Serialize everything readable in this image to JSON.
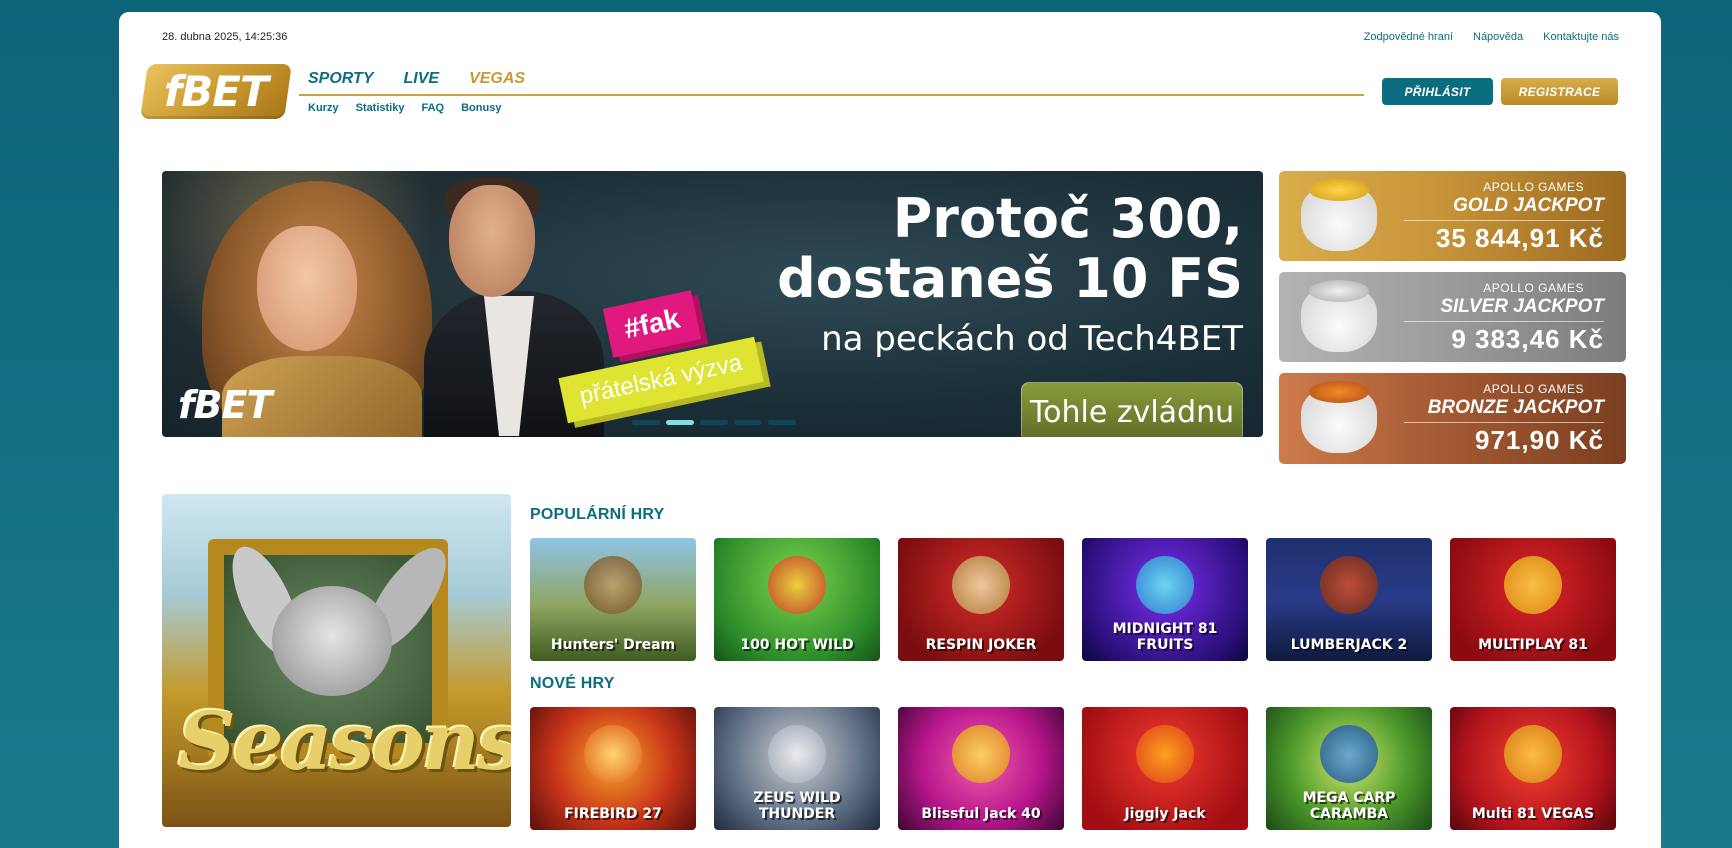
{
  "header": {
    "datetime": "28. dubna 2025, 14:25:36",
    "top_links": [
      "Zodpovědné hraní",
      "Nápověda",
      "Kontaktujte nás"
    ],
    "logo": "fBET",
    "main_nav": [
      "SPORTY",
      "LIVE",
      "VEGAS"
    ],
    "sub_nav": [
      "Kurzy",
      "Statistiky",
      "FAQ",
      "Bonusy"
    ],
    "login_label": "PŘIHLÁSIT",
    "register_label": "REGISTRACE"
  },
  "banner": {
    "logo": "fBET",
    "tag1": "#fak",
    "tag2": "přátelská výzva",
    "headline_line1": "Protoč 300,",
    "headline_line2": "dostaneš 10 FS",
    "headline_line3": "na peckách od Tech4BET",
    "cta_label": "Tohle zvládnu",
    "slide_count": 5,
    "active_slide": 2
  },
  "jackpots": [
    {
      "brand": "APOLLO GAMES",
      "name": "GOLD JACKPOT",
      "value": "35 844,91 Kč",
      "color": "#c9953a"
    },
    {
      "brand": "APOLLO GAMES",
      "name": "SILVER JACKPOT",
      "value": "9 383,46 Kč",
      "color": "#9d9d9d"
    },
    {
      "brand": "APOLLO GAMES",
      "name": "BRONZE JACKPOT",
      "value": "971,90 Kč",
      "color": "#a65b34"
    }
  ],
  "promo_tile": {
    "title": "Seasons"
  },
  "popular_games": {
    "title": "POPULÁRNÍ HRY",
    "items": [
      "Hunters' Dream",
      "100 HOT WILD",
      "RESPIN JOKER",
      "MIDNIGHT 81 FRUITS",
      "LUMBERJACK 2",
      "MULTIPLAY 81"
    ]
  },
  "new_games": {
    "title": "NOVÉ HRY",
    "items": [
      "FIREBIRD 27",
      "ZEUS WILD THUNDER",
      "Blissful Jack 40",
      "Jiggly Jack",
      "MEGA CARP CARAMBA",
      "Multi 81 VEGAS"
    ]
  },
  "colors": {
    "brand_teal": "#0b6d80",
    "brand_gold": "#c79a36",
    "background": "#136f84"
  }
}
